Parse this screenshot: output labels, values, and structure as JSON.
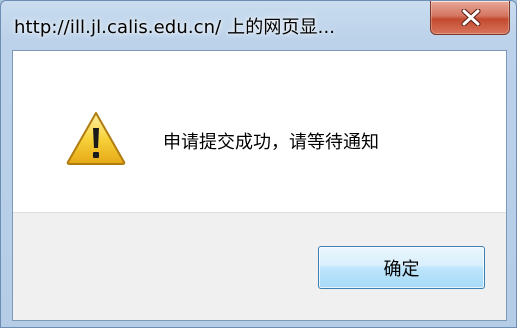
{
  "window": {
    "title": "http://ill.jl.calis.edu.cn/ 上的网页显...",
    "close_icon": "close-x-icon"
  },
  "dialog": {
    "icon": "warning-icon",
    "message": "申请提交成功，请等待通知",
    "ok_label": "确定"
  },
  "colors": {
    "frame": "#bcd2ea",
    "close_button": "#c24a2f",
    "warning_yellow": "#f7d23a",
    "button_blue": "#bee6fd"
  }
}
